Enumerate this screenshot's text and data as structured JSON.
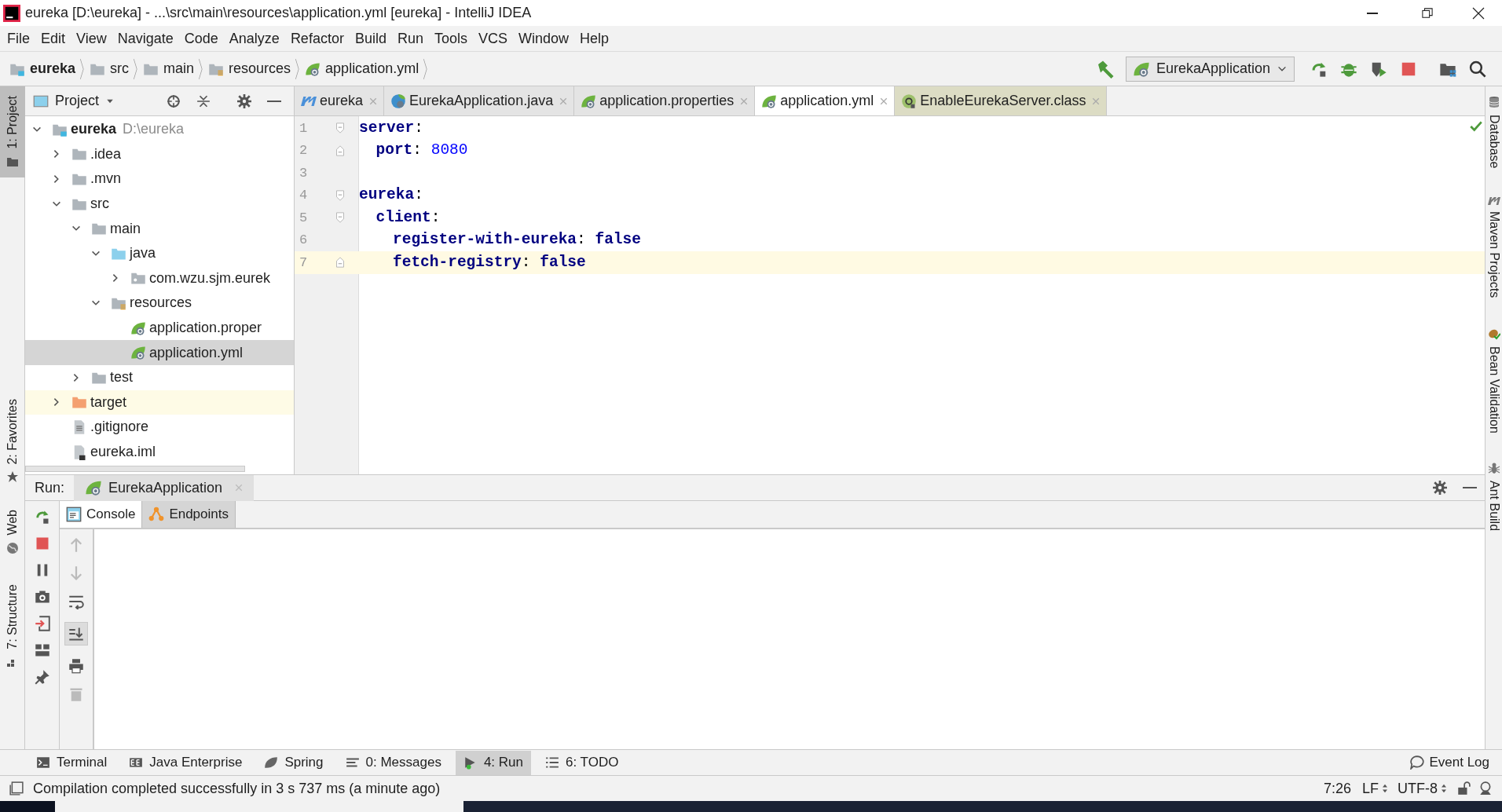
{
  "window": {
    "title": "eureka [D:\\eureka] - ...\\src\\main\\resources\\application.yml [eureka] - IntelliJ IDEA"
  },
  "menu": [
    "File",
    "Edit",
    "View",
    "Navigate",
    "Code",
    "Analyze",
    "Refactor",
    "Build",
    "Run",
    "Tools",
    "VCS",
    "Window",
    "Help"
  ],
  "breadcrumbs": [
    {
      "label": "eureka",
      "kind": "module"
    },
    {
      "label": "src",
      "kind": "folder"
    },
    {
      "label": "main",
      "kind": "folder"
    },
    {
      "label": "resources",
      "kind": "resources"
    },
    {
      "label": "application.yml",
      "kind": "spring"
    }
  ],
  "run_config": "EurekaApplication",
  "left_stripe": [
    {
      "label": "1: Project",
      "kind": "folder",
      "selected": true
    },
    {
      "label": "2: Favorites",
      "kind": "star",
      "selected": false
    },
    {
      "label": "Web",
      "kind": "globe",
      "selected": false
    },
    {
      "label": "7: Structure",
      "kind": "structure",
      "selected": false
    }
  ],
  "right_stripe": [
    {
      "label": "Database",
      "kind": "database"
    },
    {
      "label": "Maven Projects",
      "kind": "maven"
    },
    {
      "label": "Bean Validation",
      "kind": "bean"
    },
    {
      "label": "Ant Build",
      "kind": "ant"
    }
  ],
  "project_panel": {
    "title": "Project",
    "tree": [
      {
        "label": "eureka",
        "path": "D:\\eureka",
        "kind": "module",
        "expanded": true,
        "selected": false,
        "children": [
          {
            "label": ".idea",
            "kind": "folder",
            "expanded": false,
            "selected": false
          },
          {
            "label": ".mvn",
            "kind": "folder",
            "expanded": false,
            "selected": false
          },
          {
            "label": "src",
            "kind": "folder",
            "expanded": true,
            "selected": false,
            "children": [
              {
                "label": "main",
                "kind": "folder",
                "expanded": true,
                "selected": false,
                "children": [
                  {
                    "label": "java",
                    "kind": "source",
                    "expanded": true,
                    "selected": false,
                    "children": [
                      {
                        "label": "com.wzu.sjm.eurek",
                        "kind": "package",
                        "expanded": false,
                        "selected": false
                      }
                    ]
                  },
                  {
                    "label": "resources",
                    "kind": "resources",
                    "expanded": true,
                    "selected": false,
                    "children": [
                      {
                        "label": "application.proper",
                        "kind": "spring",
                        "selected": false
                      },
                      {
                        "label": "application.yml",
                        "kind": "spring",
                        "selected": true
                      }
                    ]
                  }
                ]
              },
              {
                "label": "test",
                "kind": "folder",
                "expanded": false,
                "selected": false
              }
            ]
          },
          {
            "label": "target",
            "kind": "excluded",
            "expanded": false,
            "selected": false
          },
          {
            "label": ".gitignore",
            "kind": "file",
            "selected": false
          },
          {
            "label": "eureka.iml",
            "kind": "iml",
            "selected": false
          }
        ]
      }
    ]
  },
  "editor_tabs": [
    {
      "label": "eureka",
      "kind": "maven",
      "selected": false
    },
    {
      "label": "EurekaApplication.java",
      "kind": "spring-java",
      "selected": false
    },
    {
      "label": "application.properties",
      "kind": "spring",
      "selected": false
    },
    {
      "label": "application.yml",
      "kind": "spring",
      "selected": true
    },
    {
      "label": "EnableEurekaServer.class",
      "kind": "annotation",
      "selected": false
    }
  ],
  "editor": {
    "lines": [
      {
        "number": "1",
        "current": false,
        "tokens": [
          {
            "text": "server",
            "kind": "key"
          },
          {
            "text": ":",
            "kind": "punct"
          }
        ],
        "children": [
          {
            "number": "2",
            "current": false,
            "tokens": [
              {
                "text": "port",
                "kind": "key"
              },
              {
                "text": ": ",
                "kind": "punct"
              },
              {
                "text": "8080",
                "kind": "number"
              }
            ]
          }
        ]
      },
      {
        "number": "3",
        "current": false
      },
      {
        "number": "4",
        "current": false,
        "tokens": [
          {
            "text": "eureka",
            "kind": "key"
          },
          {
            "text": ":",
            "kind": "punct"
          }
        ],
        "children": [
          {
            "number": "5",
            "current": false,
            "tokens": [
              {
                "text": "client",
                "kind": "key"
              },
              {
                "text": ":",
                "kind": "punct"
              }
            ],
            "children": [
              {
                "number": "6",
                "current": false,
                "tokens": [
                  {
                    "text": "register-with-eureka",
                    "kind": "key"
                  },
                  {
                    "text": ": ",
                    "kind": "punct"
                  },
                  {
                    "text": "false",
                    "kind": "keyword"
                  }
                ]
              },
              {
                "number": "7",
                "current": true,
                "tokens": [
                  {
                    "text": "fetch-registry",
                    "kind": "key"
                  },
                  {
                    "text": ": ",
                    "kind": "punct"
                  },
                  {
                    "text": "false",
                    "kind": "keyword"
                  }
                ]
              }
            ]
          }
        ]
      }
    ]
  },
  "run_panel": {
    "label": "Run:",
    "tab": "EurekaApplication",
    "subtabs": [
      {
        "label": "Console",
        "kind": "console",
        "selected": true
      },
      {
        "label": "Endpoints",
        "kind": "endpoints",
        "selected": false
      }
    ]
  },
  "tool_buttons": [
    {
      "label": "Terminal",
      "kind": "terminal",
      "selected": false
    },
    {
      "label": "Java Enterprise",
      "kind": "ee",
      "selected": false
    },
    {
      "label": "Spring",
      "kind": "spring",
      "selected": false
    },
    {
      "label": "0: Messages",
      "kind": "messages",
      "selected": false
    },
    {
      "label": "4: Run",
      "kind": "run",
      "selected": true
    },
    {
      "label": "6: TODO",
      "kind": "todo",
      "selected": false
    }
  ],
  "event_log": "Event Log",
  "status_bar": {
    "message": "Compilation completed successfully in 3 s 737 ms (a minute ago)",
    "position": "7:26",
    "line_separator": "LF",
    "encoding": "UTF-8"
  }
}
